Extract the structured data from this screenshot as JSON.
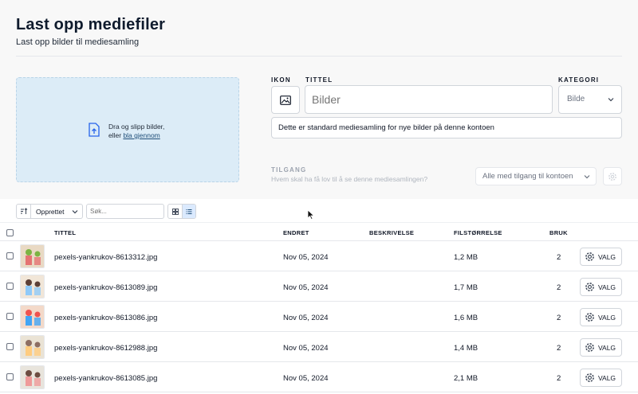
{
  "page": {
    "title": "Last opp mediefiler",
    "subtitle": "Last opp bilder til mediesamling"
  },
  "dropzone": {
    "text": "Dra og slipp bilder,",
    "text2_prefix": "eller ",
    "browse_link": "bla gjennom",
    "icon": "upload-file-icon"
  },
  "form": {
    "icon_label": "IKON",
    "title_label": "TITTEL",
    "category_label": "KATEGORI",
    "title_placeholder": "Bilder",
    "category_value": "Bilde",
    "description": "Dette er standard mediesamling for nye bilder på denne kontoen",
    "access_label": "TILGANG",
    "access_help": "Hvem skal ha få lov til å se denne mediesamlingen?",
    "access_value": "Alle med tilgang til kontoen"
  },
  "toolbar": {
    "sort_label": "Opprettet",
    "search_placeholder": "Søk..."
  },
  "table": {
    "headers": {
      "title": "TITTEL",
      "changed": "ENDRET",
      "description": "BESKRIVELSE",
      "filesize": "FILSTØRRELSE",
      "usage": "BRUK"
    },
    "action_label": "VALG",
    "rows": [
      {
        "name": "pexels-yankrukov-8613312.jpg",
        "changed": "Nov 05, 2024",
        "size": "1,2 MB",
        "usage": "2"
      },
      {
        "name": "pexels-yankrukov-8613089.jpg",
        "changed": "Nov 05, 2024",
        "size": "1,7 MB",
        "usage": "2"
      },
      {
        "name": "pexels-yankrukov-8613086.jpg",
        "changed": "Nov 05, 2024",
        "size": "1,6 MB",
        "usage": "2"
      },
      {
        "name": "pexels-yankrukov-8612988.jpg",
        "changed": "Nov 05, 2024",
        "size": "1,4 MB",
        "usage": "2"
      },
      {
        "name": "pexels-yankrukov-8613085.jpg",
        "changed": "Nov 05, 2024",
        "size": "2,1 MB",
        "usage": "2"
      }
    ]
  },
  "colors": {
    "dropzone_bg": "#dcecf7",
    "title": "#0f1b2d",
    "active_view": "#dbeafe"
  }
}
